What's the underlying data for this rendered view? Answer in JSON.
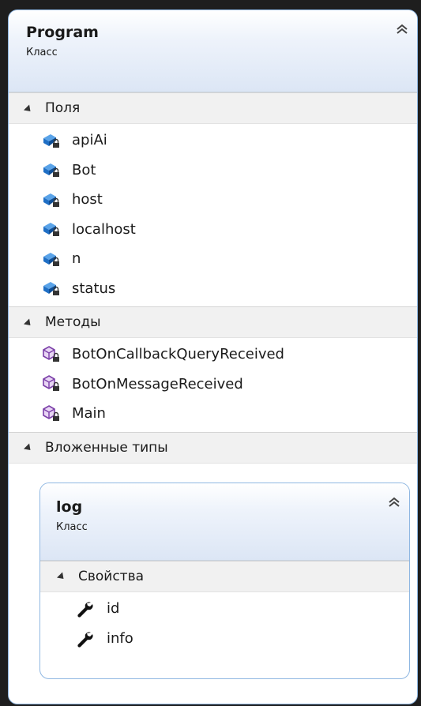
{
  "class": {
    "name": "Program",
    "kind": "Класс",
    "sections": {
      "fields": {
        "label": "Поля",
        "items": [
          "apiAi",
          "Bot",
          "host",
          "localhost",
          "n",
          "status"
        ]
      },
      "methods": {
        "label": "Методы",
        "items": [
          "BotOnCallbackQueryReceived",
          "BotOnMessageReceived",
          "Main"
        ]
      },
      "nested": {
        "label": "Вложенные типы"
      }
    }
  },
  "nested_class": {
    "name": "log",
    "kind": "Класс",
    "properties": {
      "label": "Свойства",
      "items": [
        "id",
        "info"
      ]
    }
  },
  "colors": {
    "border": "#8fb7e2",
    "field_icon": "#1f6fc5",
    "method_icon": "#7b3fa8",
    "header_gradient_end": "#dce6f5"
  },
  "icons": {
    "collapse": "double-chevron-up-icon",
    "field": "private-field-icon",
    "method": "private-method-icon",
    "property": "wrench-icon"
  }
}
